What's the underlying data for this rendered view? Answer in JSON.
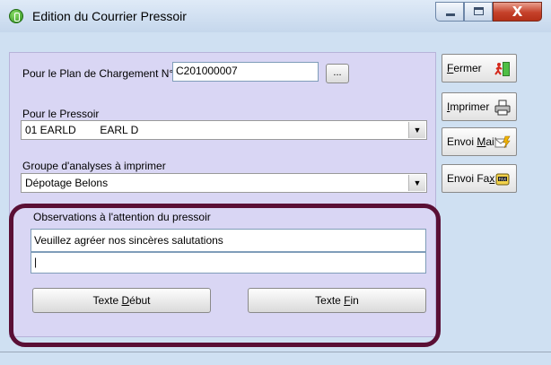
{
  "window": {
    "title": "Edition du Courrier Pressoir",
    "close_glyph": "X"
  },
  "plan": {
    "label": "Pour le Plan de Chargement N°",
    "value": "C201000007",
    "browse_label": "..."
  },
  "pressoir": {
    "label": "Pour le Pressoir",
    "selected_value": "01 EARLD        EARL D"
  },
  "groupe": {
    "label": "Groupe d'analyses à imprimer",
    "selected_value": "Dépotage Belons"
  },
  "observations": {
    "label": "Observations à l'attention du pressoir",
    "line1": "Veuillez agréer nos sincères salutations",
    "line2": "|"
  },
  "buttons": {
    "texte_debut": {
      "pre": "Texte ",
      "accel": "D",
      "post": "ébut"
    },
    "texte_fin": {
      "pre": "Texte ",
      "accel": "F",
      "post": "in"
    },
    "fermer": {
      "pre": "",
      "accel": "F",
      "post": "ermer"
    },
    "imprimer": {
      "pre": "",
      "accel": "I",
      "post": "mprimer"
    },
    "envoi_mail": {
      "pre": "Envoi ",
      "accel": "M",
      "post": "ail"
    },
    "envoi_fax": {
      "pre": "Envoi Fa",
      "accel": "x",
      "post": ""
    }
  },
  "icons": {
    "fermer": "exit-door-icon",
    "imprimer": "printer-icon",
    "envoi_mail": "mail-icon",
    "envoi_fax": "fax-icon"
  },
  "colors": {
    "frame_bg": "#d9d6f4",
    "highlight": "#5a0f35",
    "window_bg": "#cfe0f2"
  }
}
